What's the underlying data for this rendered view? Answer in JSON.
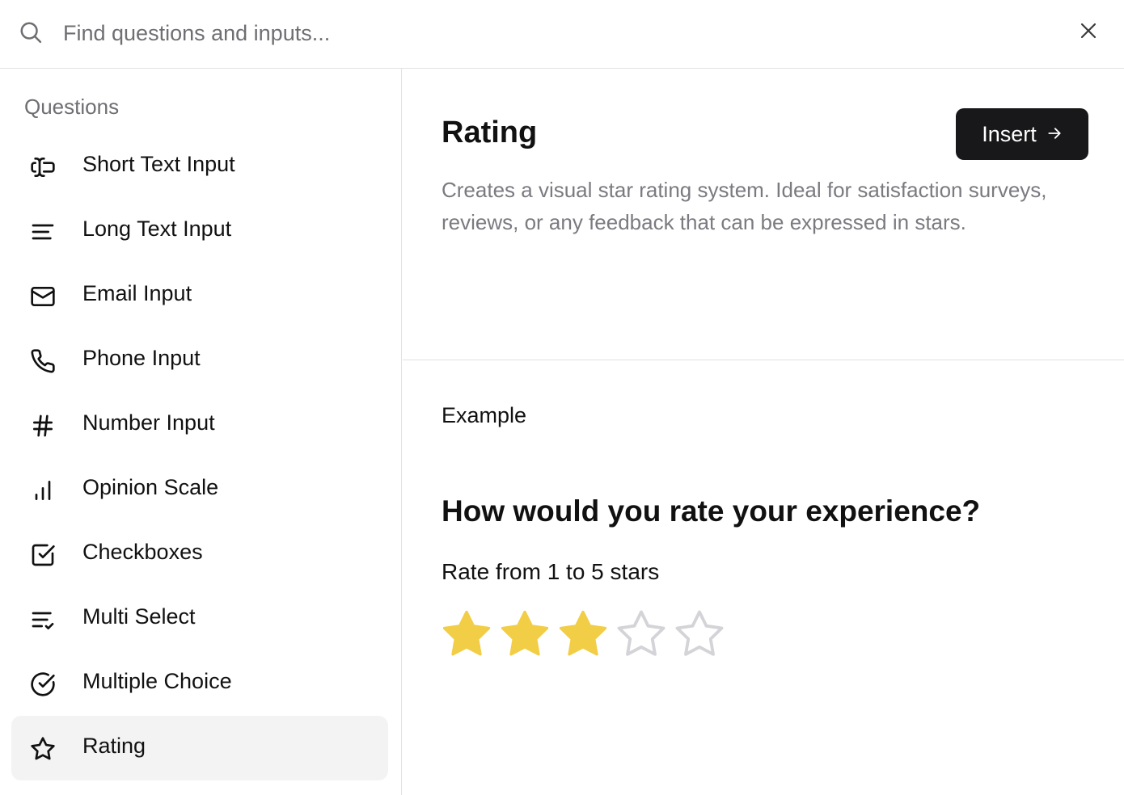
{
  "search": {
    "placeholder": "Find questions and inputs..."
  },
  "sidebar": {
    "heading": "Questions",
    "items": [
      {
        "label": "Short Text Input",
        "icon": "text-cursor-input-icon"
      },
      {
        "label": "Long Text Input",
        "icon": "align-left-icon"
      },
      {
        "label": "Email Input",
        "icon": "mail-icon"
      },
      {
        "label": "Phone Input",
        "icon": "phone-icon"
      },
      {
        "label": "Number Input",
        "icon": "hash-icon"
      },
      {
        "label": "Opinion Scale",
        "icon": "bar-chart-icon"
      },
      {
        "label": "Checkboxes",
        "icon": "checkbox-icon"
      },
      {
        "label": "Multi Select",
        "icon": "list-checks-icon"
      },
      {
        "label": "Multiple Choice",
        "icon": "circle-check-icon"
      },
      {
        "label": "Rating",
        "icon": "star-icon",
        "active": true
      }
    ]
  },
  "detail": {
    "title": "Rating",
    "insert_label": "Insert",
    "description": "Creates a visual star rating system. Ideal for satisfaction surveys, reviews, or any feedback that can be expressed in stars.",
    "example_label": "Example",
    "example": {
      "question": "How would you rate your experience?",
      "hint": "Rate from 1 to 5 stars",
      "rating": 3,
      "max": 5
    }
  },
  "colors": {
    "star_filled": "#f2cd46",
    "star_empty": "#d4d4d8",
    "button_bg": "#18181a",
    "active_item_bg": "#f3f3f4"
  }
}
